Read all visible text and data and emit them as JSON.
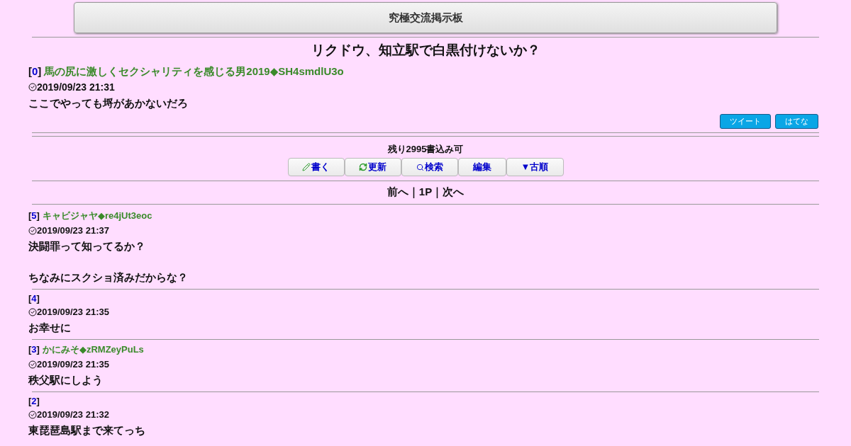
{
  "header": {
    "title": "究極交流掲示板"
  },
  "thread": {
    "title": "リクドウ、知立駅で白黒付けないか？"
  },
  "first_post": {
    "number": "0",
    "name": "馬の尻に激しくセクシャリティを感じる男2019◆SH4smdlU3o",
    "date": "2019/09/23 21:31",
    "body": "ここでやっても埒があかないだろ",
    "share_buttons": [
      "ツイート",
      "はてな"
    ]
  },
  "number_brackets": [
    "[",
    "]"
  ],
  "remaining": "残り2995書込み可",
  "toolbar": [
    {
      "kind": "write",
      "label": "書く"
    },
    {
      "kind": "refresh",
      "label": "更新"
    },
    {
      "kind": "search",
      "label": "検索"
    },
    {
      "kind": "plain",
      "label": "編集"
    },
    {
      "kind": "plain",
      "label": "▼古順"
    }
  ],
  "pager": {
    "prev": "前へ",
    "page": "1P",
    "next": "次へ",
    "separator": "｜"
  },
  "posts": [
    {
      "number": "5",
      "name": "キャビジャヤ◆re4jUt3eoc",
      "date": "2019/09/23 21:37",
      "paragraphs": [
        "決闘罪って知ってるか？",
        "ちなみにスクショ済みだからな？"
      ]
    },
    {
      "number": "4",
      "date": "2019/09/23 21:35",
      "body": "お幸せに"
    },
    {
      "number": "3",
      "name": "かにみそ◆zRMZeyPuLs",
      "date": "2019/09/23 21:35",
      "body": "秩父駅にしよう"
    },
    {
      "number": "2",
      "date": "2019/09/23 21:32",
      "body": "東琵琶島駅まで来てっち"
    }
  ]
}
